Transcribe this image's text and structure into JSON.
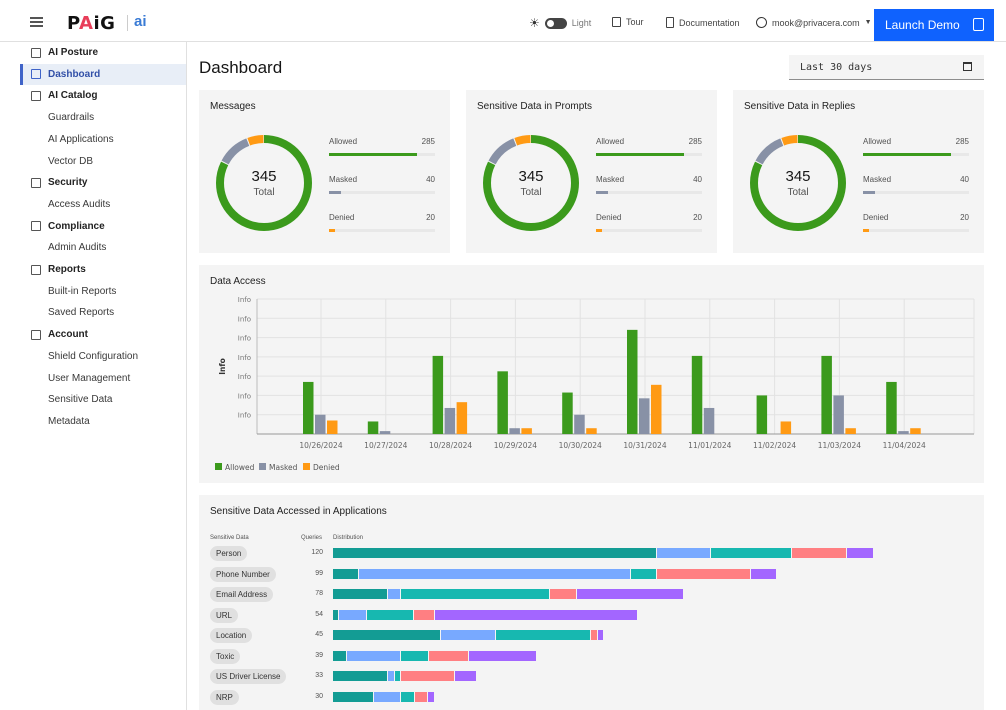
{
  "header": {
    "brand": "PAiG",
    "brand_sub": "ai",
    "theme_label": "Light",
    "tour_label": "Tour",
    "docs_label": "Documentation",
    "user_email": "mook@privacera.com",
    "launch_label": "Launch Demo"
  },
  "sidebar": {
    "items": [
      {
        "label": "AI Posture",
        "type": "head",
        "icon": "ai-posture-icon"
      },
      {
        "label": "Dashboard",
        "type": "head",
        "icon": "dashboard-icon",
        "active": true
      },
      {
        "label": "AI Catalog",
        "type": "head",
        "icon": "catalog-icon"
      },
      {
        "label": "Guardrails",
        "type": "sub"
      },
      {
        "label": "AI Applications",
        "type": "sub"
      },
      {
        "label": "Vector DB",
        "type": "sub"
      },
      {
        "label": "Security",
        "type": "head",
        "icon": "shield-icon"
      },
      {
        "label": "Access Audits",
        "type": "sub"
      },
      {
        "label": "Compliance",
        "type": "head",
        "icon": "compliance-icon"
      },
      {
        "label": "Admin Audits",
        "type": "sub"
      },
      {
        "label": "Reports",
        "type": "head",
        "icon": "clipboard-icon"
      },
      {
        "label": "Built-in Reports",
        "type": "sub"
      },
      {
        "label": "Saved Reports",
        "type": "sub"
      },
      {
        "label": "Account",
        "type": "head",
        "icon": "account-icon"
      },
      {
        "label": "Shield Configuration",
        "type": "sub"
      },
      {
        "label": "User Management",
        "type": "sub"
      },
      {
        "label": "Sensitive Data",
        "type": "sub"
      },
      {
        "label": "Metadata",
        "type": "sub"
      }
    ]
  },
  "page": {
    "title": "Dashboard",
    "date_range": "Last 30 days"
  },
  "summary_cards": [
    {
      "title": "Messages",
      "total": "345",
      "total_label": "Total",
      "stats": [
        {
          "label": "Allowed",
          "value": 285
        },
        {
          "label": "Masked",
          "value": 40
        },
        {
          "label": "Denied",
          "value": 20
        }
      ]
    },
    {
      "title": "Sensitive Data in Prompts",
      "total": "345",
      "total_label": "Total",
      "stats": [
        {
          "label": "Allowed",
          "value": 285
        },
        {
          "label": "Masked",
          "value": 40
        },
        {
          "label": "Denied",
          "value": 20
        }
      ]
    },
    {
      "title": "Sensitive Data in Replies",
      "total": "345",
      "total_label": "Total",
      "stats": [
        {
          "label": "Allowed",
          "value": 285
        },
        {
          "label": "Masked",
          "value": 40
        },
        {
          "label": "Denied",
          "value": 20
        }
      ]
    }
  ],
  "colors": {
    "allowed": "#3b9a1c",
    "masked": "#8891a6",
    "denied": "#ff9a14",
    "accent": "#0f62fe",
    "dist": [
      "#139c94",
      "#78a9ff",
      "#17b8b0",
      "#ff7f82",
      "#a366ff"
    ]
  },
  "chart_data": [
    {
      "type": "bar",
      "title": "Data Access",
      "xlabel": "",
      "ylabel": "Info",
      "ytick_labels": [
        "Info",
        "Info",
        "Info",
        "Info",
        "Info",
        "Info",
        "Info"
      ],
      "ylim": [
        0,
        7
      ],
      "grid": true,
      "legend_position": "bottom-left",
      "categories": [
        "10/26/2024",
        "10/27/2024",
        "10/28/2024",
        "10/29/2024",
        "10/30/2024",
        "10/31/2024",
        "11/01/2024",
        "11/02/2024",
        "11/03/2024",
        "11/04/2024"
      ],
      "series": [
        {
          "name": "Allowed",
          "values": [
            2.7,
            0.65,
            4.05,
            3.25,
            2.15,
            5.4,
            4.05,
            2.0,
            4.05,
            2.7
          ]
        },
        {
          "name": "Masked",
          "values": [
            1.0,
            0.15,
            1.35,
            0.3,
            1.0,
            1.85,
            1.35,
            0,
            2.0,
            0.15
          ]
        },
        {
          "name": "Denied",
          "values": [
            0.7,
            0,
            1.65,
            0.3,
            0.3,
            2.55,
            0,
            0.65,
            0.3,
            0.3
          ]
        }
      ]
    },
    {
      "type": "bar",
      "title": "Sensitive Data Accessed in Applications",
      "columns": [
        "Sensitive Data",
        "Queries",
        "Distribution"
      ],
      "rows": [
        {
          "label": "Person",
          "queries": 120,
          "segments": [
            62,
            10.5,
            15.5,
            10.5,
            5.2
          ]
        },
        {
          "label": "Phone Number",
          "queries": 99,
          "segments": [
            5,
            52,
            5,
            18,
            5
          ]
        },
        {
          "label": "Email Address",
          "queries": 78,
          "segments": [
            10.5,
            2.6,
            28.5,
            5.2,
            20.5
          ]
        },
        {
          "label": "URL",
          "queries": 54,
          "segments": [
            1.2,
            5.3,
            9,
            4,
            39
          ]
        },
        {
          "label": "Location",
          "queries": 45,
          "segments": [
            20.7,
            10.5,
            18.2,
            1.3,
            1.3
          ]
        },
        {
          "label": "Toxic",
          "queries": 39,
          "segments": [
            2.6,
            10.5,
            5.2,
            7.8,
            13
          ]
        },
        {
          "label": "US Driver License",
          "queries": 33,
          "segments": [
            10.5,
            1.3,
            1.3,
            10.2,
            4.2
          ]
        },
        {
          "label": "NRP",
          "queries": 30,
          "segments": [
            7.8,
            5.3,
            2.6,
            2.6,
            1.3
          ]
        }
      ]
    }
  ],
  "legend": [
    "Allowed",
    "Masked",
    "Denied"
  ]
}
